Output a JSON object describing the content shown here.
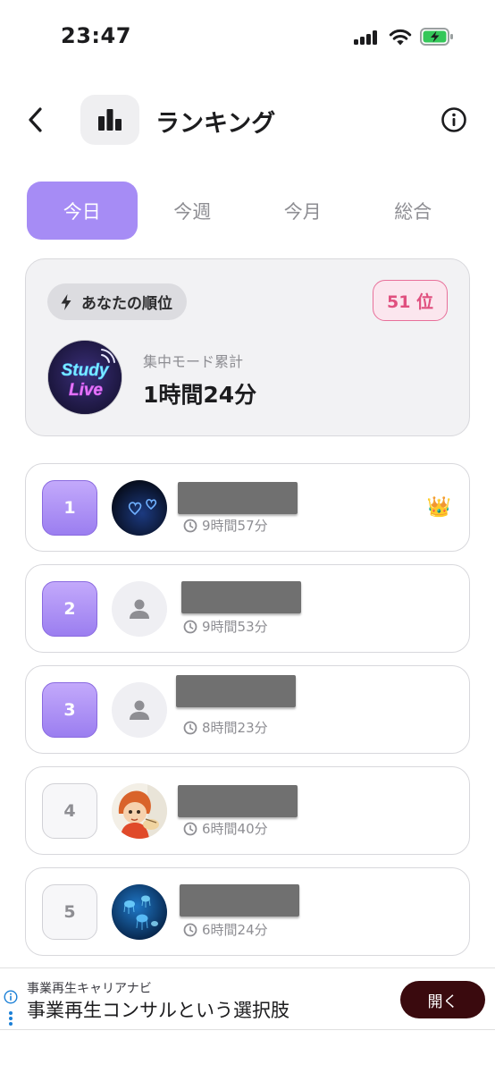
{
  "status_bar": {
    "time": "23:47"
  },
  "header": {
    "title": "ランキング"
  },
  "tabs": [
    {
      "label": "今日",
      "active": true
    },
    {
      "label": "今週",
      "active": false
    },
    {
      "label": "今月",
      "active": false
    },
    {
      "label": "総合",
      "active": false
    }
  ],
  "my_rank": {
    "pill_label": "あなたの順位",
    "rank": "51 位",
    "avatar_text_line1": "Study",
    "avatar_text_line2": "Live",
    "stat_label": "集中モード累計",
    "stat_value": "1時間24分"
  },
  "ranking": [
    {
      "rank": "1",
      "time": "9時間57分",
      "avatar": "hearts-photo",
      "crown": true
    },
    {
      "rank": "2",
      "time": "9時間53分",
      "avatar": "default-user",
      "crown": false
    },
    {
      "rank": "3",
      "time": "8時間23分",
      "avatar": "default-user",
      "crown": false
    },
    {
      "rank": "4",
      "time": "6時間40分",
      "avatar": "anime-photo",
      "crown": false
    },
    {
      "rank": "5",
      "time": "6時間24分",
      "avatar": "jellyfish-photo",
      "crown": false
    }
  ],
  "ad": {
    "subtitle": "事業再生キャリアナビ",
    "title": "事業再生コンサルという選択肢",
    "button": "開く"
  },
  "colors": {
    "accent": "#a68cf5",
    "rank_badge": "#e0507f",
    "ad_button": "#3a0a0e"
  }
}
